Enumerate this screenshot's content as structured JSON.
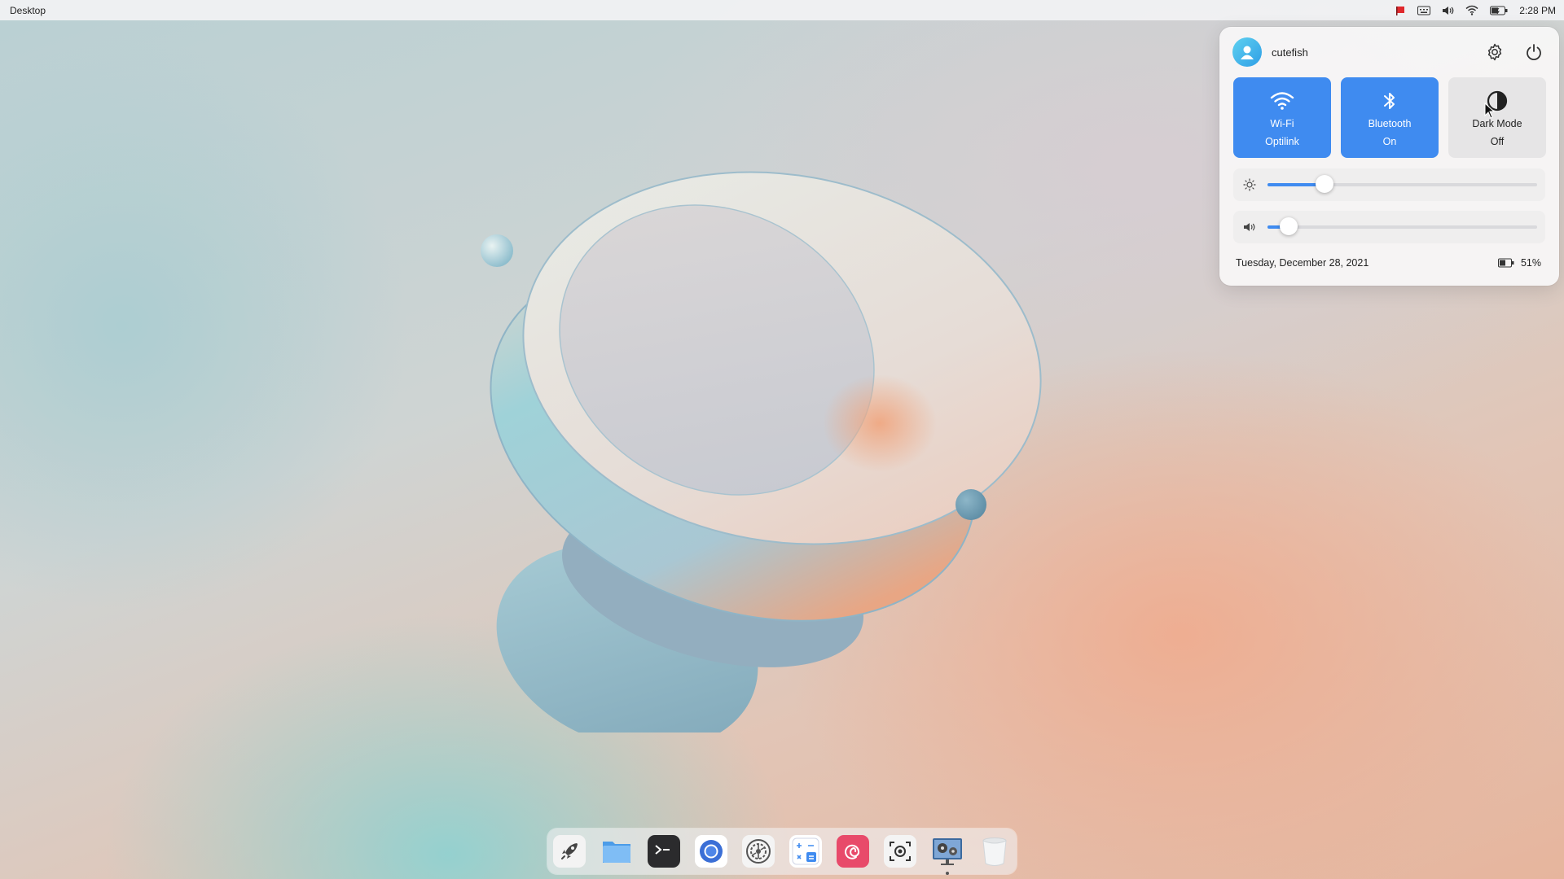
{
  "topbar": {
    "title": "Desktop",
    "clock": "2:28 PM",
    "tray_icons": [
      "flag-icon",
      "keyboard-icon",
      "volume-icon",
      "wifi-icon",
      "battery-icon"
    ]
  },
  "control_center": {
    "username": "cutefish",
    "tiles": [
      {
        "name": "Wi-Fi",
        "status": "Optilink",
        "state": "on",
        "icon": "wifi-icon"
      },
      {
        "name": "Bluetooth",
        "status": "On",
        "state": "on",
        "icon": "bluetooth-icon"
      },
      {
        "name": "Dark Mode",
        "status": "Off",
        "state": "off",
        "icon": "dark-mode-icon"
      }
    ],
    "brightness_level": 0.21,
    "volume_level": 0.08,
    "date": "Tuesday, December 28, 2021",
    "battery": "51%",
    "accent_color": "#3f8bf0"
  },
  "dock": {
    "items": [
      "launcher-icon",
      "file-manager-icon",
      "terminal-icon",
      "browser-icon",
      "settings-icon",
      "calculator-icon",
      "debian-installer-icon",
      "screenshot-icon",
      "system-tool-icon",
      "trash-icon"
    ]
  }
}
